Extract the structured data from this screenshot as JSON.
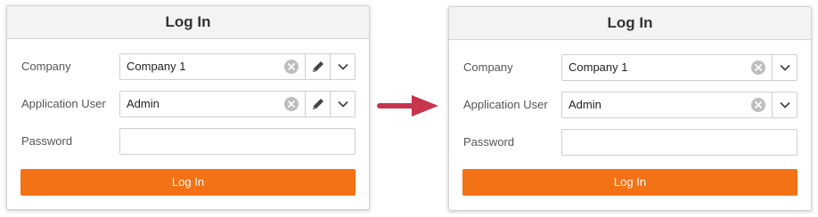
{
  "left_panel": {
    "title": "Log In",
    "company": {
      "label": "Company",
      "value": "Company 1"
    },
    "application_user": {
      "label": "Application User",
      "value": "Admin"
    },
    "password": {
      "label": "Password",
      "value": ""
    },
    "login_button": "Log In"
  },
  "right_panel": {
    "title": "Log In",
    "company": {
      "label": "Company",
      "value": "Company 1"
    },
    "application_user": {
      "label": "Application User",
      "value": "Admin"
    },
    "password": {
      "label": "Password",
      "value": ""
    },
    "login_button": "Log In"
  },
  "colors": {
    "accent": "#f47216",
    "arrow": "#c8334d"
  },
  "icons": [
    "clear-icon",
    "pencil-icon",
    "chevron-down-icon",
    "arrow-right-icon"
  ]
}
